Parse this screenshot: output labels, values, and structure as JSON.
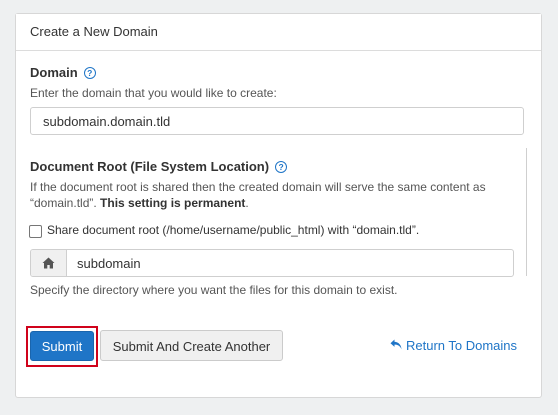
{
  "panel": {
    "title": "Create a New Domain"
  },
  "domain": {
    "label": "Domain",
    "help": "Enter the domain that you would like to create:",
    "value": "subdomain.domain.tld"
  },
  "docroot": {
    "label": "Document Root (File System Location)",
    "help_line1": "If the document root is shared then the created domain will serve the same content as",
    "help_line2_plain": "“domain.tld”. ",
    "help_line2_bold": "This setting is permanent",
    "help_line2_end": ".",
    "checkbox_label": "Share document root (/home/username/public_html) with “domain.tld”.",
    "checkbox_checked": false,
    "input_value": "subdomain",
    "addon_icon": "home-icon",
    "hint": "Specify the directory where you want the files for this domain to exist."
  },
  "actions": {
    "submit_label": "Submit",
    "submit_another_label": "Submit And Create Another",
    "return_label": "Return To Domains",
    "return_icon": "reply-icon"
  },
  "colors": {
    "accent": "#1f75c7",
    "highlight": "#d0021b"
  }
}
